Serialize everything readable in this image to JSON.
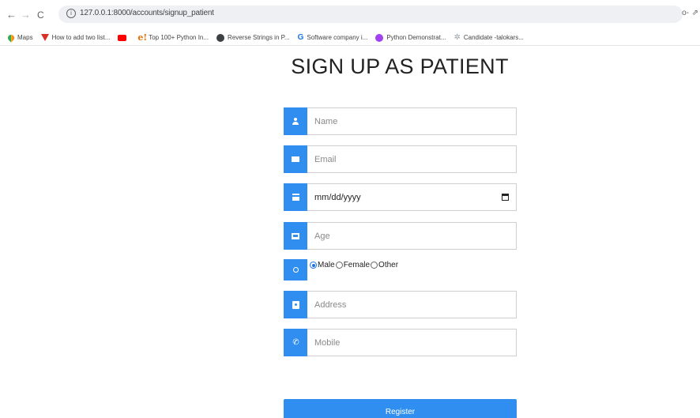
{
  "browser": {
    "url": "127.0.0.1:8000/accounts/signup_patient",
    "bookmarks": [
      {
        "label": "Maps",
        "icon": "maps-icon"
      },
      {
        "label": "How to add two list...",
        "icon": "v-icon"
      },
      {
        "label": "",
        "icon": "youtube-icon"
      },
      {
        "label": "Top 100+ Python In...",
        "icon": "e-icon"
      },
      {
        "label": "Reverse Strings in P...",
        "icon": "reverse-strings-icon"
      },
      {
        "label": "Software company i...",
        "icon": "software-company-icon"
      },
      {
        "label": "Python Demonstrat...",
        "icon": "python-icon"
      },
      {
        "label": "Candidate -talokars...",
        "icon": "candidate-icon"
      }
    ]
  },
  "page": {
    "title": "SIGN UP AS PATIENT"
  },
  "form": {
    "name_placeholder": "Name",
    "email_placeholder": "Email",
    "dob_value": "mm/dd/yyyy",
    "age_placeholder": "Age",
    "gender_options": [
      "Male",
      "Female",
      "Other"
    ],
    "gender_selected": "Male",
    "address_placeholder": "Address",
    "mobile_placeholder": "Mobile",
    "register_label": "Register"
  },
  "colors": {
    "accent": "#2f8ef0"
  }
}
